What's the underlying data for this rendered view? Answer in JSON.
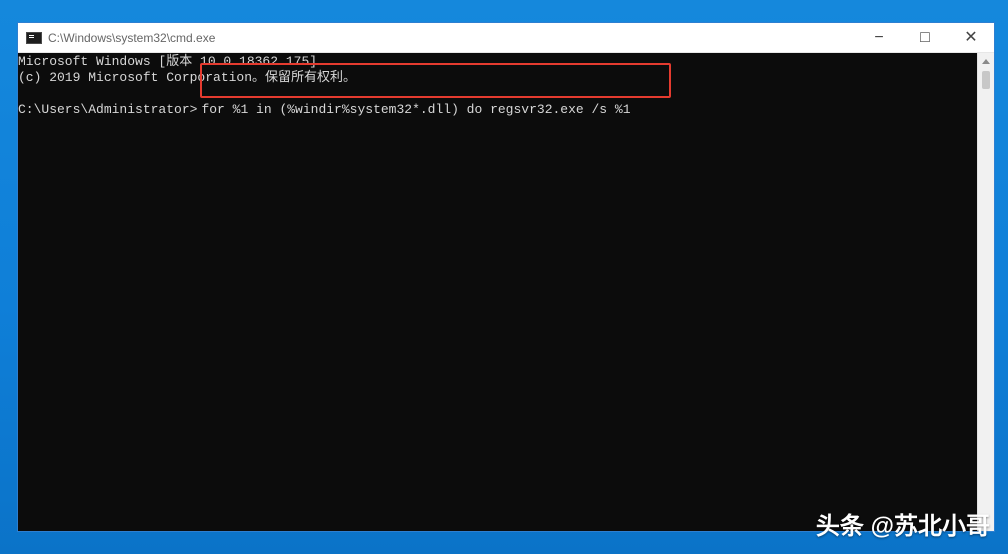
{
  "window": {
    "title": "C:\\Windows\\system32\\cmd.exe",
    "controls": {
      "minimize": "−",
      "maximize": "□",
      "close": "✕"
    }
  },
  "console": {
    "lines": [
      "Microsoft Windows [版本 10.0.18362.175]",
      "(c) 2019 Microsoft Corporation。保留所有权利。"
    ],
    "prompt": "C:\\Users\\Administrator>",
    "command": "for %1 in (%windir%system32*.dll) do regsvr32.exe /s %1"
  },
  "watermark": {
    "text": "头条 @苏北小哥"
  },
  "colors": {
    "background": "#0f7fd8",
    "console_background": "#0c0c0c",
    "console_text": "#d7d7d7",
    "highlight_border": "#e53b2f"
  }
}
